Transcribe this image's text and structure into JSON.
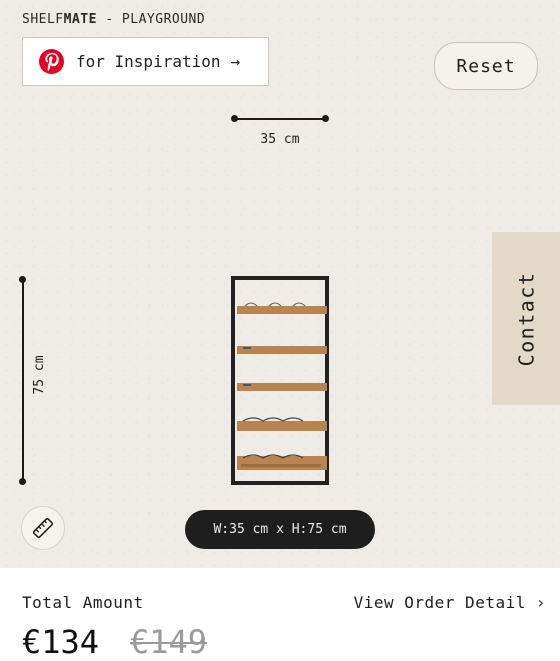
{
  "brand": {
    "prefix": "SHELF",
    "bold": "MATE",
    "suffix": " - PLAYGROUND"
  },
  "inspiration": {
    "label": "for Inspiration",
    "arrow": "→",
    "icon": "pinterest-icon",
    "icon_color": "#e60023"
  },
  "reset": {
    "label": "Reset"
  },
  "dimensions": {
    "width_label": "35 cm",
    "height_label": "75 cm",
    "summary": "W:35 cm x H:75 cm"
  },
  "contact": {
    "label": "Contact"
  },
  "tools": {
    "ruler_icon": "ruler-icon"
  },
  "footer": {
    "total_label": "Total Amount",
    "view_order_label": "View Order Detail",
    "view_order_chevron": "›",
    "price": "€134",
    "old_price": "€149"
  },
  "colors": {
    "canvas_bg": "#efebe6",
    "contact_tab": "#e4d8c8",
    "pill_bg": "#1e1e1e",
    "frame": "#222222",
    "wood": "#b88552"
  }
}
